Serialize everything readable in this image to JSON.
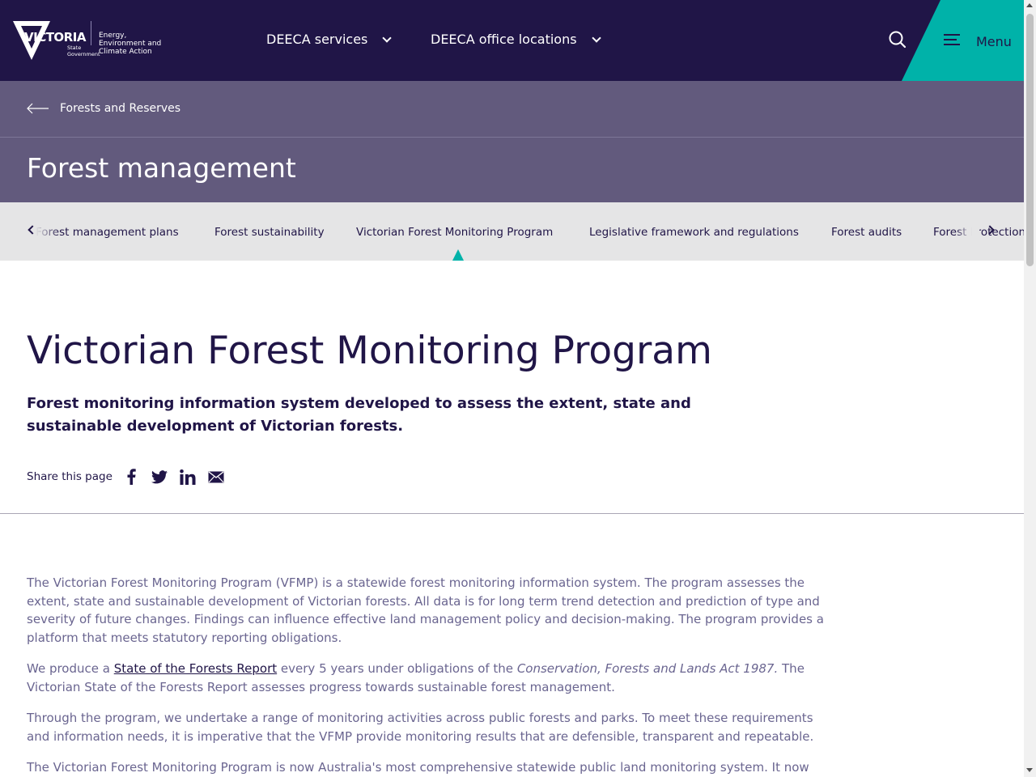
{
  "header": {
    "logo": {
      "wordmark": "VICTORIA",
      "sub_line1": "State",
      "sub_line2": "Government",
      "department": "Energy, Environment and Climate Action"
    },
    "nav": [
      {
        "label": "DEECA services"
      },
      {
        "label": "DEECA office locations"
      }
    ],
    "search_icon": "search-icon",
    "menu_label": "Menu"
  },
  "breadcrumb": {
    "back_label": "Forests and Reserves"
  },
  "section": {
    "title": "Forest management"
  },
  "tabs": [
    {
      "label": "Forest management plans"
    },
    {
      "label": "Forest sustainability"
    },
    {
      "label": "Victorian Forest Monitoring Program",
      "active": true
    },
    {
      "label": "Legislative framework and regulations"
    },
    {
      "label": "Forest audits"
    },
    {
      "label": "Forest Protection"
    }
  ],
  "page": {
    "title": "Victorian Forest Monitoring Program",
    "intro": "Forest monitoring information system developed to assess the extent, state and sustainable development of Victorian forests.",
    "share_label": "Share this page",
    "share_icons": [
      "facebook-icon",
      "twitter-icon",
      "linkedin-icon",
      "email-icon"
    ]
  },
  "body": {
    "p1": "The Victorian Forest Monitoring Program (VFMP) is a statewide forest monitoring information system. The program assesses the extent, state and sustainable development of Victorian forests. All data is for long term trend detection and prediction of type and severity of future changes. Findings can influence effective land management policy and decision-making. The program provides a platform that meets statutory reporting obligations.",
    "p2_before": "We produce a ",
    "p2_link": "State of the Forests Report",
    "p2_middle": " every 5 years under obligations of the ",
    "p2_act": "Conservation, Forests and Lands Act 1987.",
    "p2_after": " The Victorian State of the Forests Report assesses progress towards sustainable forest management.",
    "p3": "Through the program, we undertake a range of monitoring activities across public forests and parks. To meet these requirements and information needs, it is imperative that the VFMP provide monitoring results that are defensible, transparent and repeatable.",
    "p4": "The Victorian Forest Monitoring Program is now Australia's most comprehensive statewide public land monitoring system. It now"
  },
  "colors": {
    "navy": "#201547",
    "teal": "#00b2a9",
    "band": "#625a7d",
    "tabs_bg": "#e5e5e6",
    "body_text": "#6a6590"
  }
}
